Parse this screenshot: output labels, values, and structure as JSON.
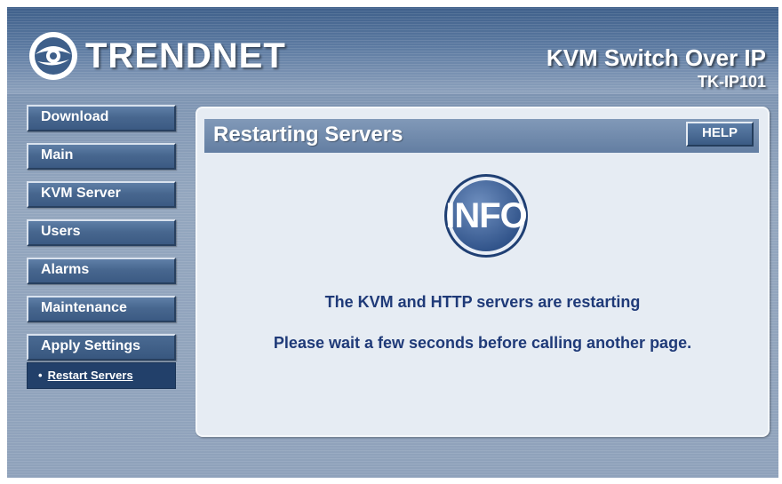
{
  "brand": {
    "logo_text": "TRENDNET"
  },
  "header": {
    "product_title": "KVM Switch Over IP",
    "model": "TK-IP101"
  },
  "sidebar": {
    "items": [
      {
        "label": "Download"
      },
      {
        "label": "Main"
      },
      {
        "label": "KVM Server"
      },
      {
        "label": "Users"
      },
      {
        "label": "Alarms"
      },
      {
        "label": "Maintenance"
      },
      {
        "label": "Apply Settings"
      }
    ],
    "sub_item": {
      "bullet": "•",
      "label": "Restart Servers"
    }
  },
  "main": {
    "title": "Restarting Servers",
    "help_label": "HELP",
    "info_badge": "INFO",
    "message_1": "The KVM and HTTP servers are restarting",
    "message_2": "Please wait a few seconds before calling another page."
  },
  "colors": {
    "header_blue": "#3e5f8a",
    "button_blue": "#48678f",
    "message_text": "#1f3a78",
    "panel_bg": "#e6ecf3"
  }
}
